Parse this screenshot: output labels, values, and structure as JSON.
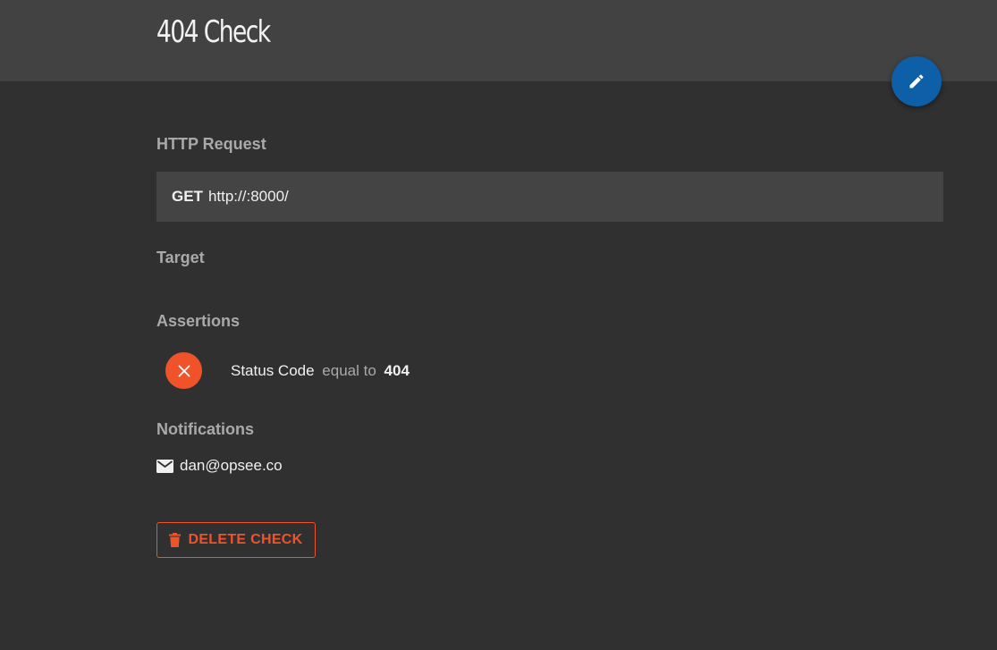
{
  "header": {
    "title": "404 Check",
    "edit_button": {
      "icon": "pencil-icon",
      "color": "#0d5fa8"
    }
  },
  "http_request": {
    "heading": "HTTP Request",
    "method": "GET",
    "url": "http://:8000/"
  },
  "target": {
    "heading": "Target"
  },
  "assertions": {
    "heading": "Assertions",
    "items": [
      {
        "status": "failing",
        "status_icon": "x-icon",
        "status_color": "#f0532a",
        "key": "Status Code",
        "relationship": "equal to",
        "operand": "404"
      }
    ]
  },
  "notifications": {
    "heading": "Notifications",
    "items": [
      {
        "type": "email",
        "icon": "mail-icon",
        "value": "dan@opsee.co"
      }
    ]
  },
  "actions": {
    "delete_label": "DELETE CHECK",
    "delete_icon": "trash-icon",
    "delete_color": "#f0532a"
  },
  "colors": {
    "background": "#303030",
    "header_background": "#424242",
    "panel_background": "#444444",
    "heading_text": "#a9a9a9",
    "accent_danger": "#f0532a",
    "accent_primary": "#0d5fa8"
  }
}
